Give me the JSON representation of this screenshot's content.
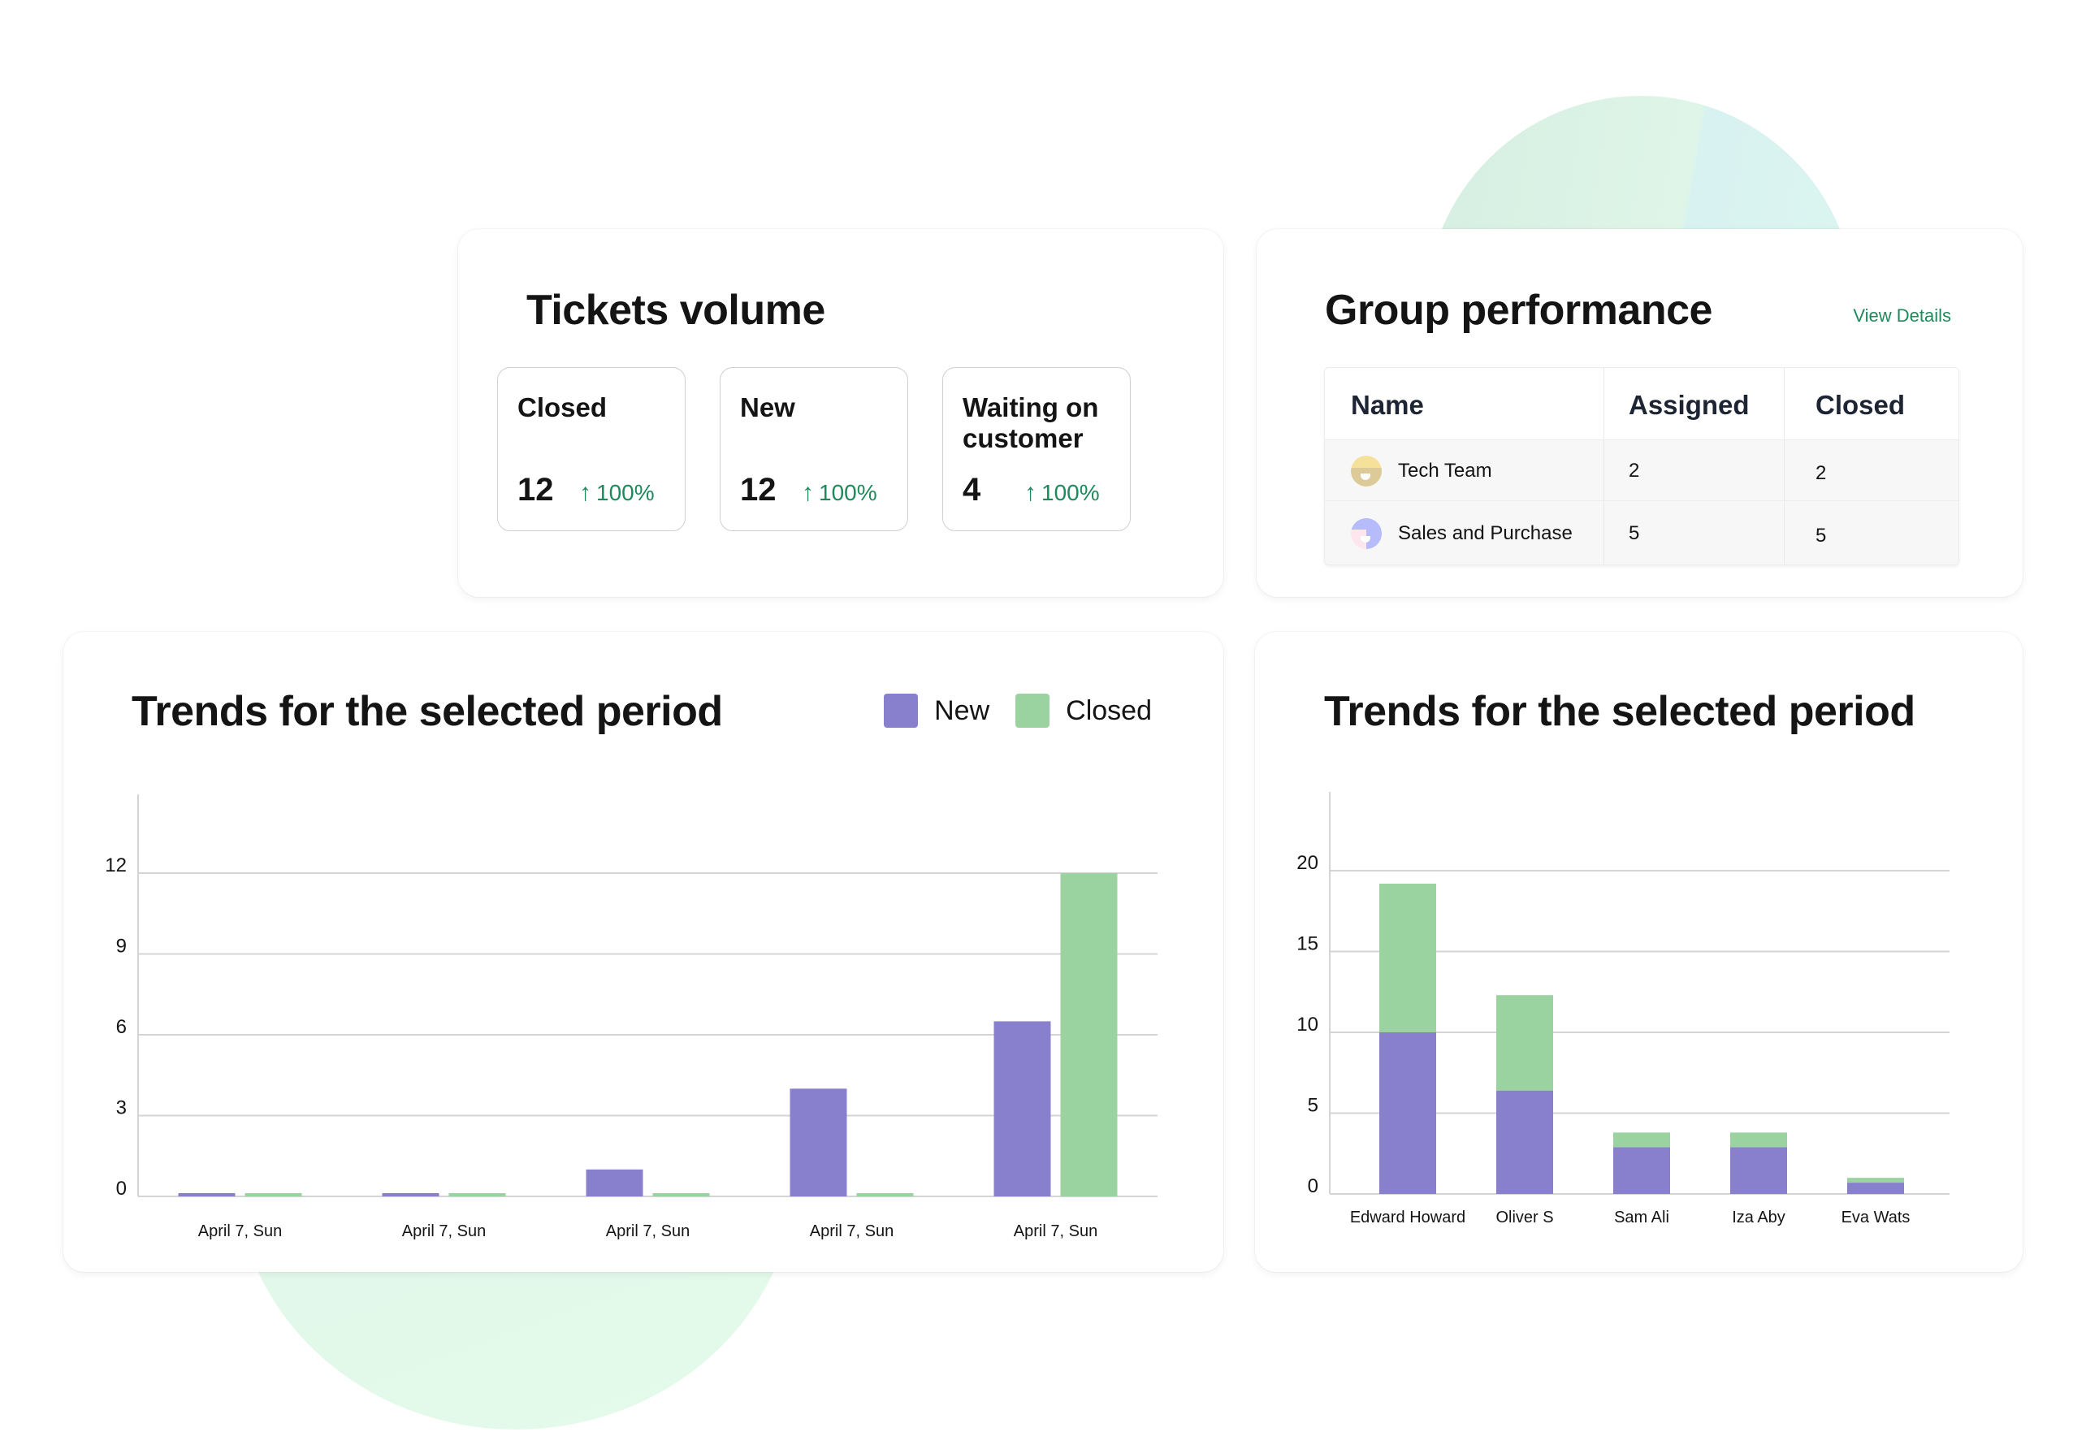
{
  "tickets_volume": {
    "title": "Tickets volume",
    "stats": [
      {
        "label": "Closed",
        "value": "12",
        "change": "100%",
        "trend_icon": "arrow-up-icon"
      },
      {
        "label": "New",
        "value": "12",
        "change": "100%",
        "trend_icon": "arrow-up-icon"
      },
      {
        "label": "Waiting on customer",
        "value": "4",
        "change": "100%",
        "trend_icon": "arrow-up-icon"
      }
    ],
    "accent_color": "#1e8a5c"
  },
  "group_performance": {
    "title": "Group performance",
    "view_details_label": "View Details",
    "columns": [
      "Name",
      "Assigned",
      "Closed"
    ],
    "rows": [
      {
        "name": "Tech Team",
        "assigned": "2",
        "closed": "2",
        "avatar_icon": "team-avatar-icon"
      },
      {
        "name": "Sales and Purchase",
        "assigned": "5",
        "closed": "5",
        "avatar_icon": "team-avatar-icon"
      }
    ]
  },
  "colors": {
    "new": "#8880cc",
    "closed": "#9ad3a0",
    "grid": "#d4d4d4"
  },
  "chart_data": [
    {
      "type": "bar",
      "title": "Trends for the selected period",
      "categories": [
        "April 7, Sun",
        "April 7, Sun",
        "April 7, Sun",
        "April 7, Sun",
        "April 7, Sun"
      ],
      "series": [
        {
          "name": "New",
          "values": [
            0,
            0,
            1,
            4,
            6.5
          ]
        },
        {
          "name": "Closed",
          "values": [
            0,
            0,
            0,
            0,
            12
          ]
        }
      ],
      "yticks": [
        0,
        3,
        6,
        9,
        12
      ],
      "ylim": [
        0,
        14.5
      ],
      "xlabel": "",
      "ylabel": "",
      "grid": true,
      "legend": "top-right"
    },
    {
      "type": "bar",
      "stacked": true,
      "title": "Trends for the selected period",
      "categories": [
        "Edward Howard",
        "Oliver S",
        "Sam Ali",
        "Iza Aby",
        "Eva Wats"
      ],
      "series": [
        {
          "name": "New",
          "values": [
            10,
            6.4,
            2.9,
            2.9,
            0.7
          ]
        },
        {
          "name": "Closed",
          "values": [
            9.2,
            5.9,
            0.9,
            0.9,
            0.3
          ]
        }
      ],
      "yticks": [
        0,
        5,
        10,
        15,
        20
      ],
      "ylim": [
        0,
        25
      ],
      "xlabel": "",
      "ylabel": "",
      "grid": true,
      "legend": "none"
    }
  ]
}
